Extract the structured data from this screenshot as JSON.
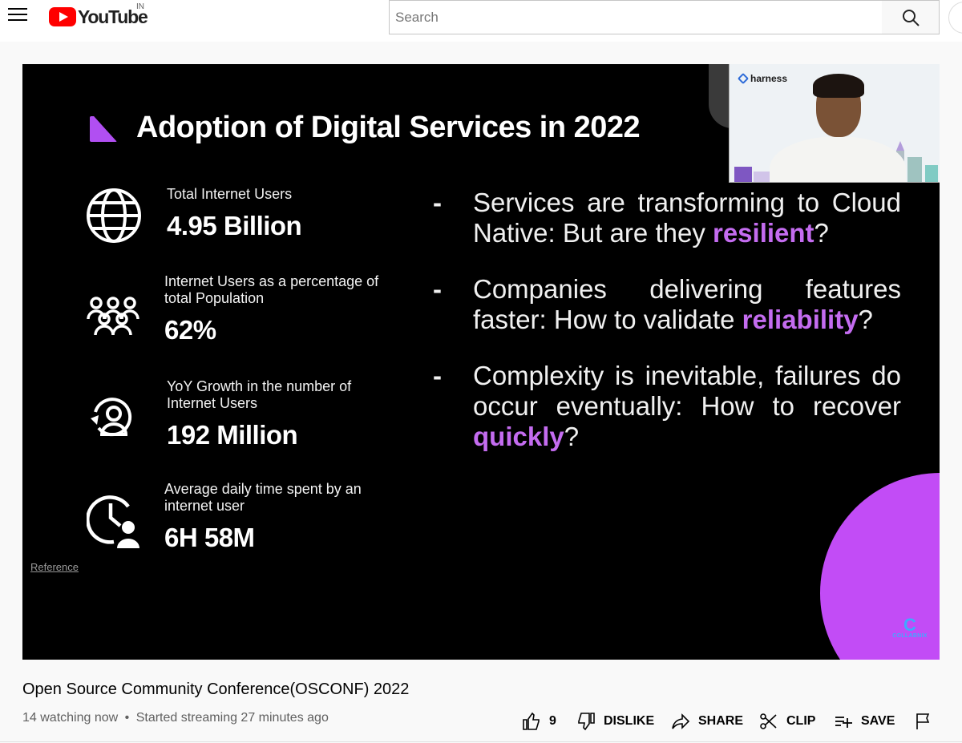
{
  "header": {
    "logo_text": "YouTube",
    "country": "IN",
    "search_placeholder": "Search"
  },
  "slide": {
    "title": "Adoption of Digital Services in 2022",
    "stats": [
      {
        "label": "Total Internet Users",
        "value": "4.95 Billion",
        "icon": "globe-icon"
      },
      {
        "label": "Internet Users as a percentage of total Population",
        "value": "62%",
        "icon": "people-group-icon"
      },
      {
        "label": "YoY Growth in the number of Internet Users",
        "value": "192 Million",
        "icon": "user-growth-icon"
      },
      {
        "label": "Average daily time spent by an internet user",
        "value": "6H 58M",
        "icon": "clock-user-icon"
      }
    ],
    "bullets": [
      {
        "dash": "-",
        "text": "Services are transforming to Cloud Native: But are they ",
        "highlight": "resilient",
        "end": "?"
      },
      {
        "dash": "-",
        "text": "Companies delivering features faster: How to validate ",
        "highlight": "reliability",
        "end": "?"
      },
      {
        "dash": "-",
        "text": "Complexity is inevitable, failures do occur eventually: How to recover ",
        "highlight": "quickly",
        "end": "?"
      }
    ],
    "reference": "Reference",
    "camera_brand": "harness",
    "watermark": "COLLABNIX",
    "colors": {
      "accent": "#c46cf0",
      "marker": "#b14ff2",
      "circle": "#c24cf6"
    }
  },
  "video": {
    "title": "Open Source Community Conference(OSCONF) 2022",
    "watching": "14 watching now",
    "separator": "•",
    "started": "Started streaming 27 minutes ago"
  },
  "actions": {
    "like_count": "9",
    "dislike": "DISLIKE",
    "share": "SHARE",
    "clip": "CLIP",
    "save": "SAVE"
  }
}
